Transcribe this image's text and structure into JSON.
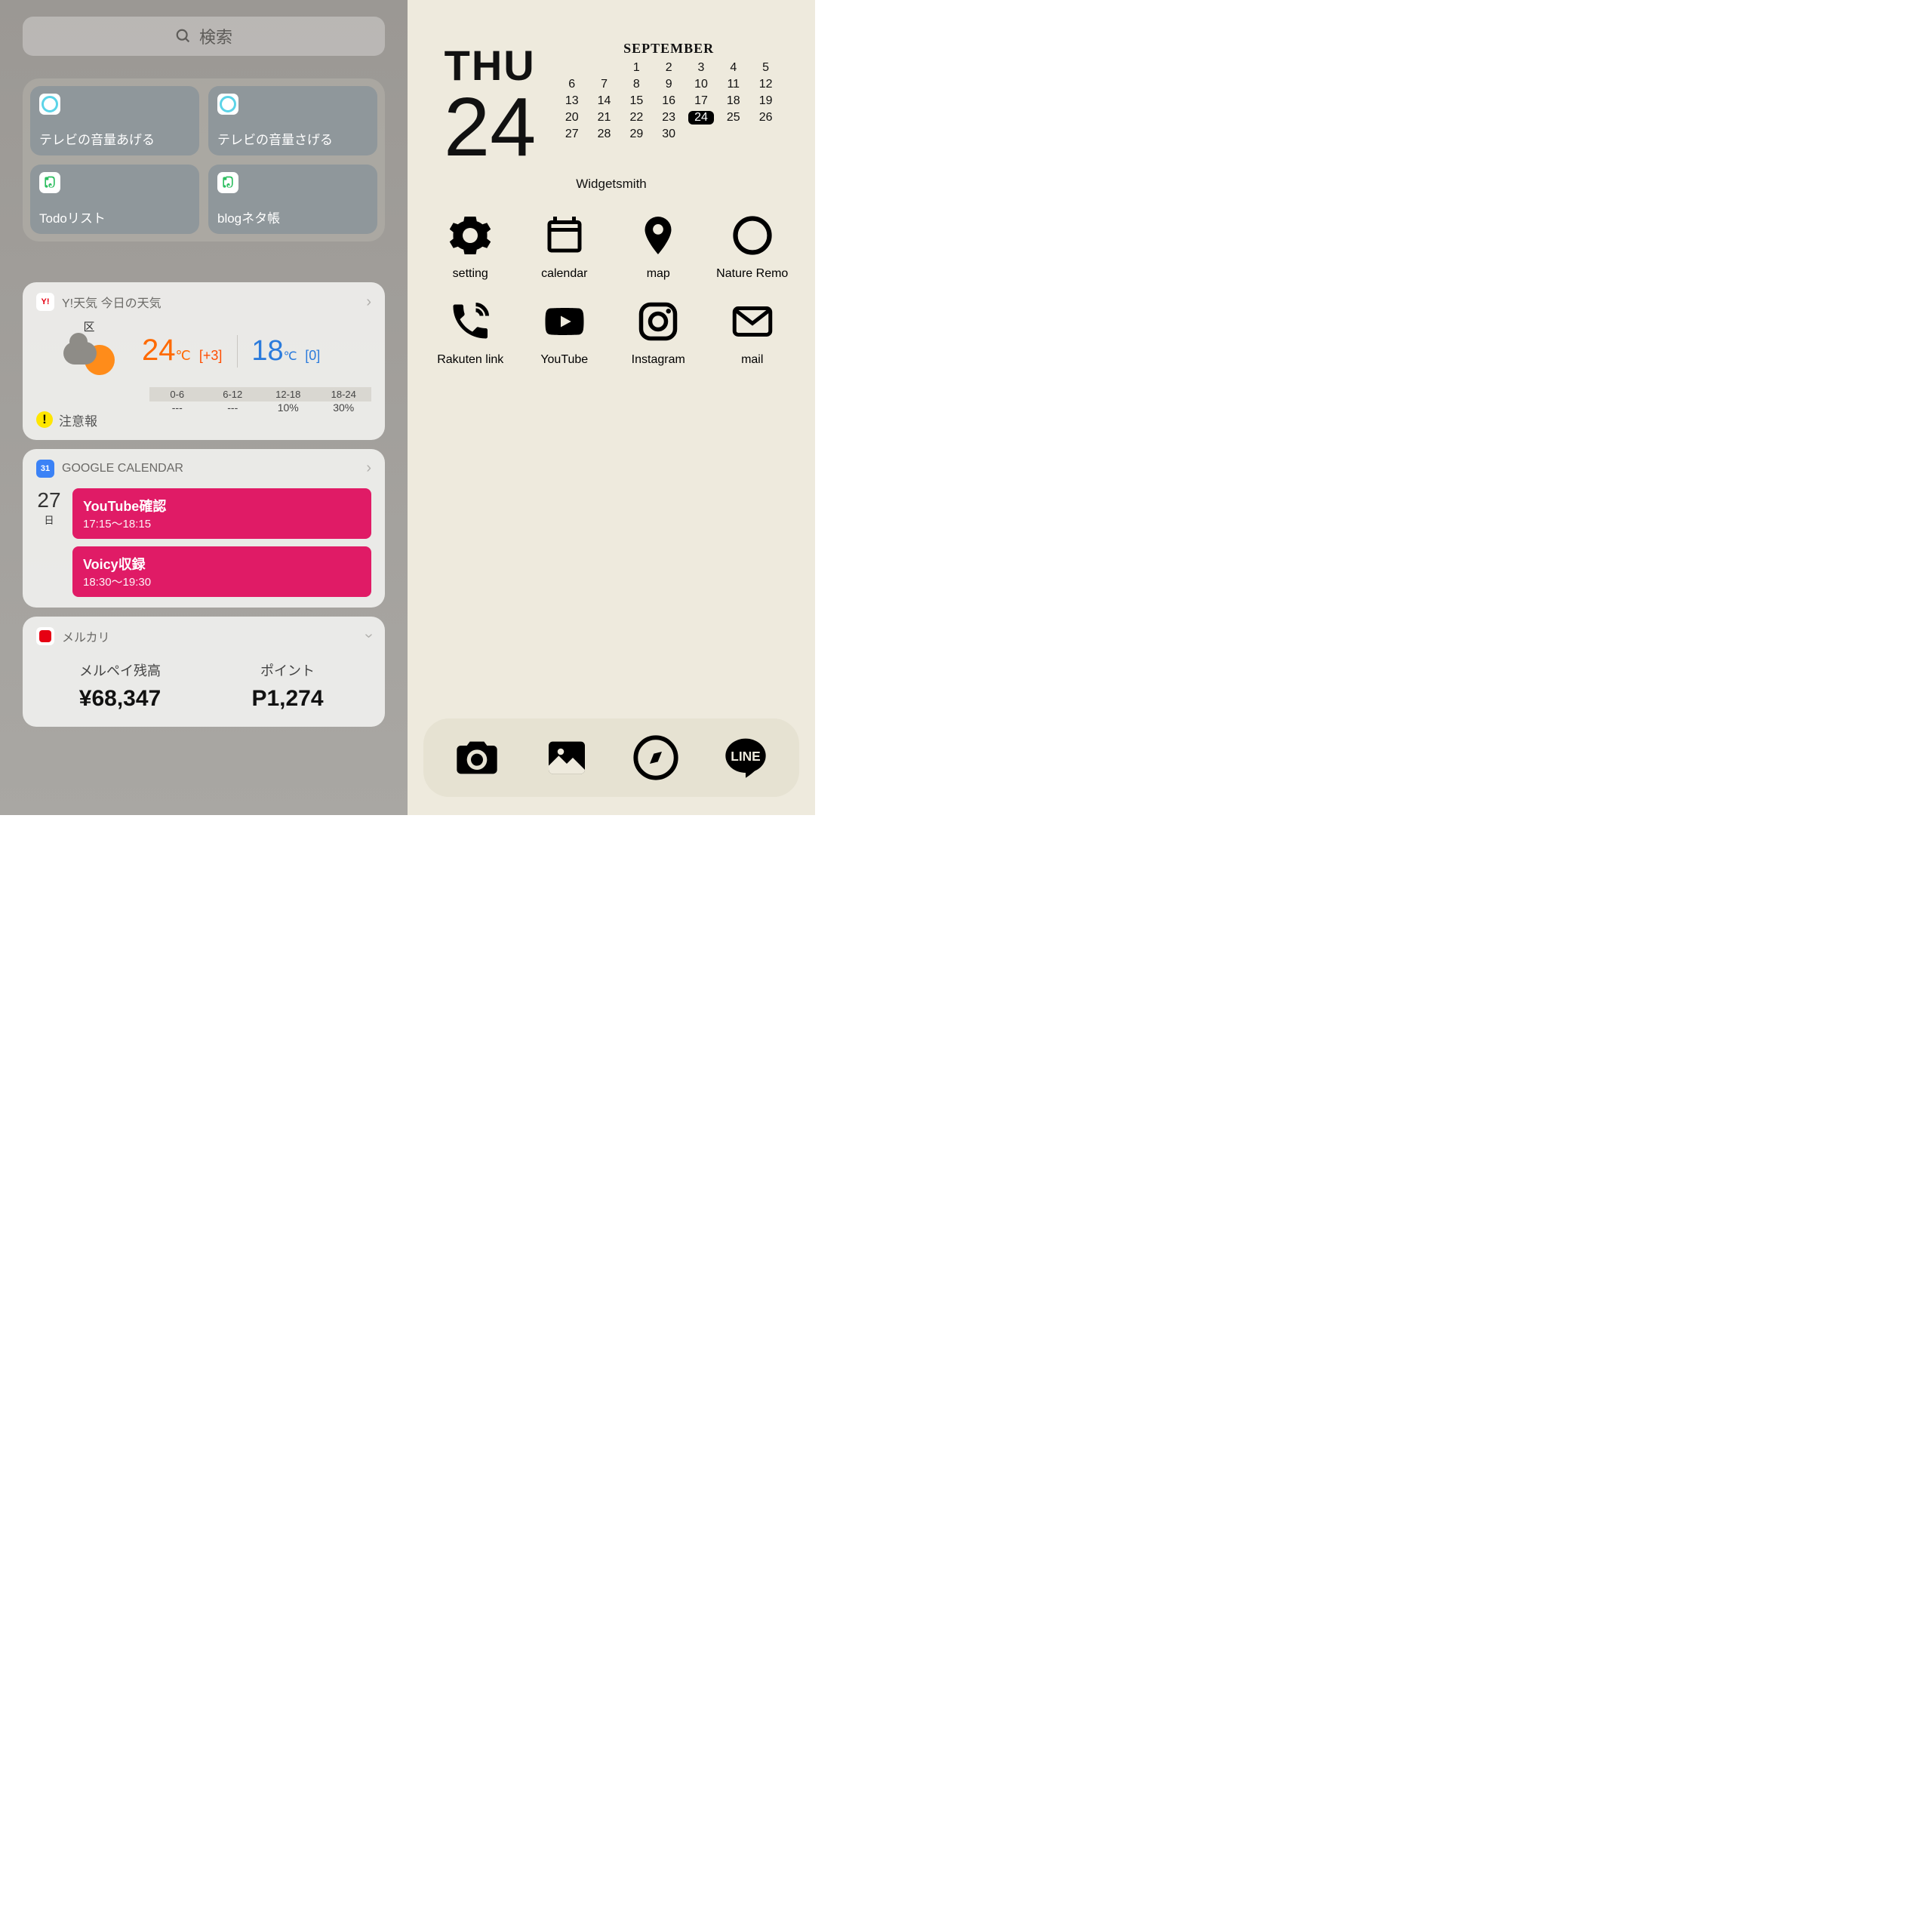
{
  "search": {
    "placeholder": "検索"
  },
  "shortcuts": [
    {
      "label": "テレビの音量あげる",
      "icon": "remo"
    },
    {
      "label": "テレビの音量さげる",
      "icon": "remo"
    },
    {
      "label": "Todoリスト",
      "icon": "ever"
    },
    {
      "label": "blogネタ帳",
      "icon": "ever"
    }
  ],
  "weather": {
    "title": "Y!天気 今日の天気",
    "area": "区",
    "high": "24",
    "high_unit": "℃",
    "high_diff": "[+3]",
    "low": "18",
    "low_unit": "℃",
    "low_diff": "[0]",
    "slots": [
      "0-6",
      "6-12",
      "12-18",
      "18-24"
    ],
    "pops": [
      "---",
      "---",
      "10%",
      "30%"
    ],
    "alert": "注意報"
  },
  "gcal": {
    "title": "GOOGLE CALENDAR",
    "date_num": "27",
    "date_day": "日",
    "events": [
      {
        "title": "YouTube確認",
        "time": "17:15〜18:15"
      },
      {
        "title": "Voicy収録",
        "time": "18:30〜19:30"
      }
    ]
  },
  "mercari": {
    "title": "メルカリ",
    "balance_label": "メルペイ残高",
    "balance": "¥68,347",
    "points_label": "ポイント",
    "points": "P1,274"
  },
  "calwidget": {
    "dow": "THU",
    "daynum": "24",
    "month": "SEPTEMBER",
    "today": 24,
    "cells": [
      "",
      "",
      "1",
      "2",
      "3",
      "4",
      "5",
      "6",
      "7",
      "8",
      "9",
      "10",
      "11",
      "12",
      "13",
      "14",
      "15",
      "16",
      "17",
      "18",
      "19",
      "20",
      "21",
      "22",
      "23",
      "24",
      "25",
      "26",
      "27",
      "28",
      "29",
      "30",
      "",
      "",
      ""
    ],
    "caption": "Widgetsmith"
  },
  "apps": [
    {
      "label": "setting",
      "icon": "gear"
    },
    {
      "label": "calendar",
      "icon": "calendar"
    },
    {
      "label": "map",
      "icon": "pin"
    },
    {
      "label": "Nature Remo",
      "icon": "circle"
    },
    {
      "label": "Rakuten link",
      "icon": "phone"
    },
    {
      "label": "YouTube",
      "icon": "youtube"
    },
    {
      "label": "Instagram",
      "icon": "instagram"
    },
    {
      "label": "mail",
      "icon": "mail"
    }
  ],
  "dock": [
    "camera",
    "photo",
    "compass",
    "line"
  ]
}
